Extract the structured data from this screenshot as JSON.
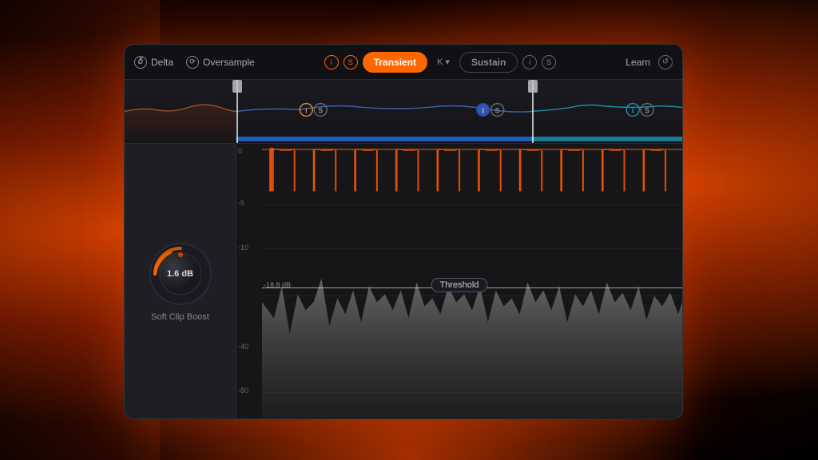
{
  "background": {
    "colors": {
      "primary_fire": "#c84000",
      "dark_bg": "#1a0500"
    }
  },
  "toolbar": {
    "delta_label": "Delta",
    "oversample_label": "Oversample",
    "transient_label": "Transient",
    "sustain_label": "Sustain",
    "learn_label": "Learn",
    "mode_k_label": "K",
    "info_icon": "i",
    "solo_icon": "S"
  },
  "knob": {
    "value": "1.6 dB",
    "label": "Soft Clip Boost"
  },
  "analyzer": {
    "db_labels": [
      "0",
      "-5",
      "-10",
      "-18.8 dB",
      "-40",
      "-80"
    ],
    "threshold_value": "-18.8 dB",
    "threshold_label": "Threshold"
  },
  "waveform": {
    "markers": [
      {
        "position": 140
      },
      {
        "position": 510
      }
    ]
  }
}
